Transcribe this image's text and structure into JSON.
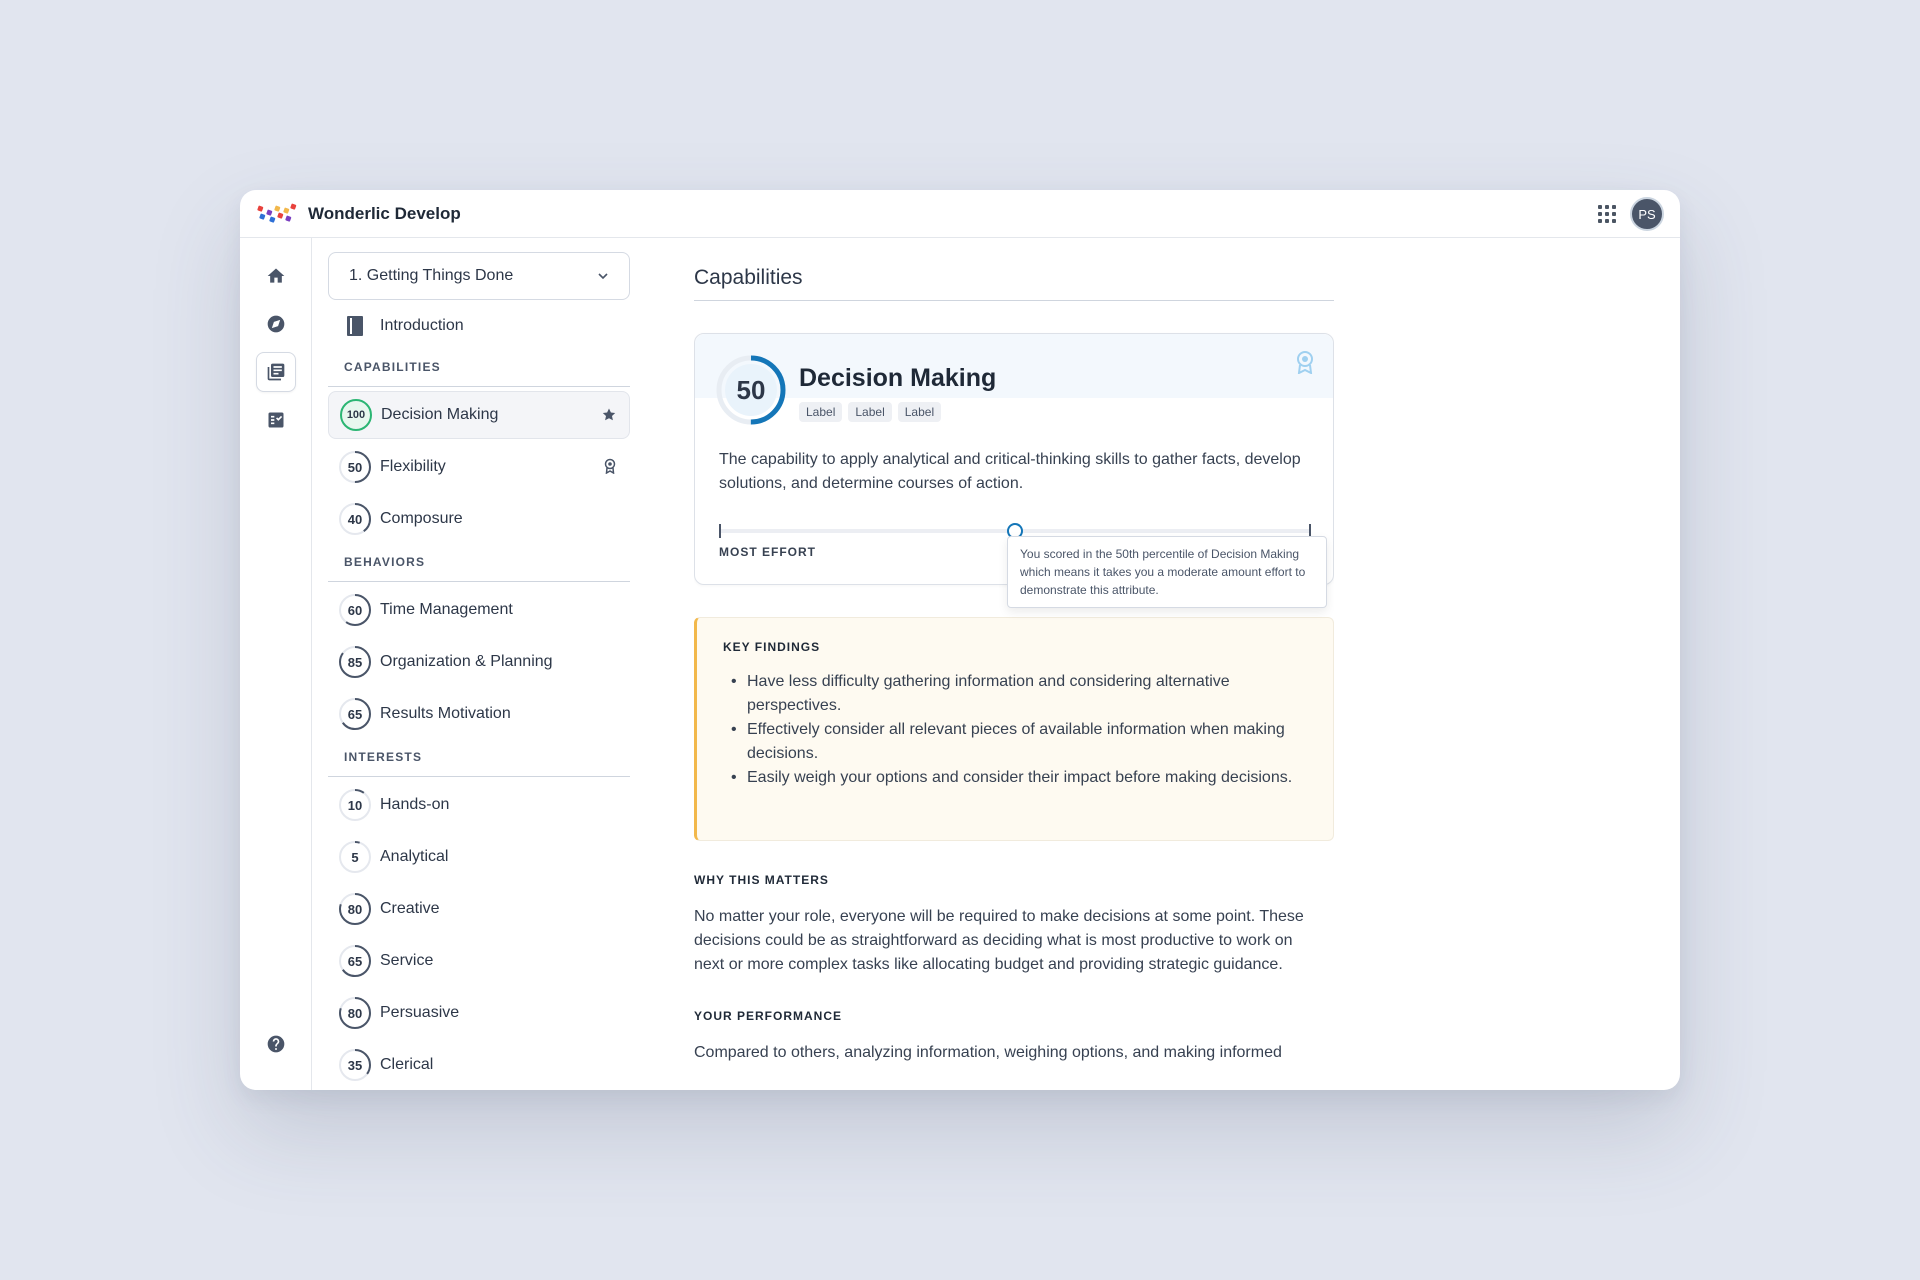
{
  "header": {
    "app_title": "Wonderlic Develop",
    "avatar_initials": "PS"
  },
  "rail": {
    "icons": [
      "home-icon",
      "compass-icon",
      "library-icon",
      "checklist-icon",
      "help-icon"
    ],
    "active": "library-icon"
  },
  "sidebar": {
    "dropdown_value": "1. Getting Things Done",
    "intro_label": "Introduction",
    "sections": [
      {
        "title": "CAPABILITIES",
        "items": [
          {
            "score": "100",
            "label": "Decision Making",
            "active": true,
            "badge": "star-icon",
            "ring_color": "#2bb673"
          },
          {
            "score": "50",
            "label": "Flexibility",
            "badge": "ribbon-icon"
          },
          {
            "score": "40",
            "label": "Composure"
          }
        ]
      },
      {
        "title": "BEHAVIORS",
        "items": [
          {
            "score": "60",
            "label": "Time Management"
          },
          {
            "score": "85",
            "label": "Organization & Planning"
          },
          {
            "score": "65",
            "label": "Results Motivation"
          }
        ]
      },
      {
        "title": "INTERESTS",
        "items": [
          {
            "score": "10",
            "label": "Hands-on"
          },
          {
            "score": "5",
            "label": "Analytical"
          },
          {
            "score": "80",
            "label": "Creative"
          },
          {
            "score": "65",
            "label": "Service"
          },
          {
            "score": "80",
            "label": "Persuasive"
          },
          {
            "score": "35",
            "label": "Clerical"
          }
        ]
      }
    ]
  },
  "main": {
    "page_title": "Capabilities",
    "card": {
      "score": "50",
      "score_fraction": 0.5,
      "name": "Decision Making",
      "tags": [
        "Label",
        "Label",
        "Label"
      ],
      "description": "The capability to apply analytical and critical-thinking skills to gather facts, develop solutions, and determine courses of action.",
      "slider_percentile": 0.5,
      "slider_label": "MOST EFFORT",
      "tooltip": "You scored in the 50th percentile of Decision Making which means it takes you a moderate amount effort to demonstrate this attribute.",
      "accent_color": "#1476b8"
    },
    "key_findings": {
      "title": "KEY FINDINGS",
      "items": [
        "Have less difficulty gathering information and considering alternative perspectives.",
        "Effectively consider all relevant pieces of available information when making decisions.",
        "Easily weigh your options and consider their impact before making decisions."
      ]
    },
    "why_matters": {
      "title": "WHY THIS MATTERS",
      "text": "No matter your role, everyone will be required to make decisions at some point. These decisions could be as straightforward as deciding what is most productive to work on next or more complex tasks like allocating budget and providing strategic guidance."
    },
    "performance": {
      "title": "YOUR PERFORMANCE",
      "text": "Compared to others, analyzing information, weighing options, and making informed"
    }
  }
}
